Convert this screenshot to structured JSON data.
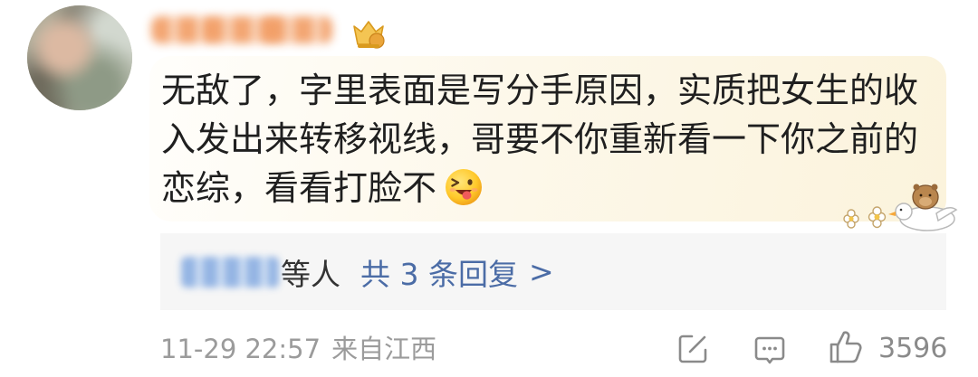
{
  "comment": {
    "lines": [
      "无敌了，字里表面是写分手原因，实质把女生的收",
      "入发出来转移视线，哥要不你重新看一下你之前的",
      "恋综，看看打脸不"
    ],
    "emoji_icon": "winking-tongue-emoji-icon",
    "decoration_icon": "capybara-riding-duck-icon"
  },
  "author": {
    "badge_icon": "fan-badge-icon"
  },
  "replies": {
    "suffix": "等人",
    "link_label": "共 3 条回复",
    "chevron": ">"
  },
  "meta": {
    "timestamp": "11-29 22:57",
    "location": "来自江西"
  },
  "actions": {
    "share_icon": "share-icon",
    "comment_icon": "comment-icon",
    "like_icon": "thumbs-up-icon",
    "like_count": "3596"
  },
  "colors": {
    "comment_text": "#1f1f1f",
    "link_blue": "#4b6ca6",
    "meta_gray": "#9b9b9b",
    "reply_box_bg": "#f6f6f6",
    "bubble_bg": "#fdf8ea"
  }
}
